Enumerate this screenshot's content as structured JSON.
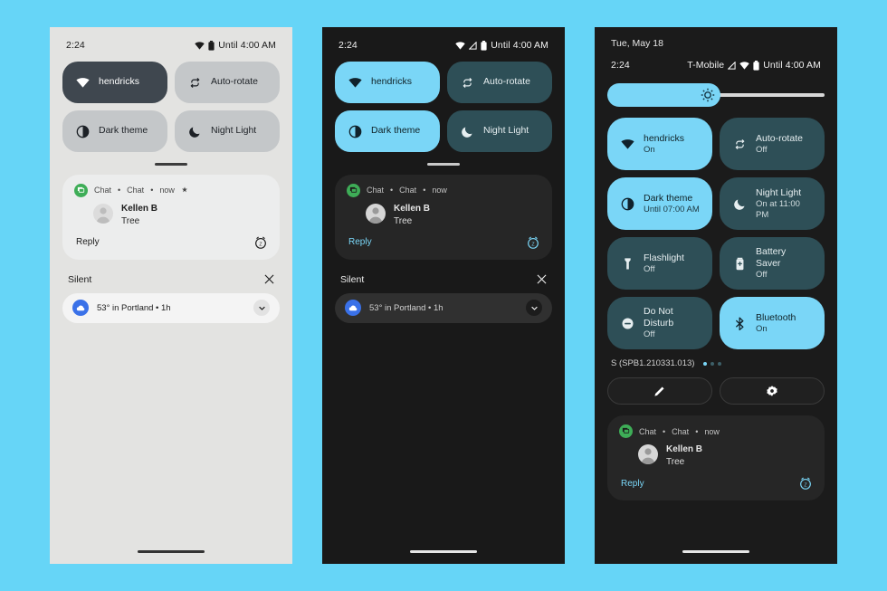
{
  "background_color": "#66d5f7",
  "phones": [
    {
      "id": "phone-light",
      "theme": "light",
      "status": {
        "time": "2:24",
        "battery_text": "Until 4:00 AM"
      },
      "tiles": [
        {
          "label": "hendricks",
          "state": "on",
          "icon": "wifi-icon"
        },
        {
          "label": "Auto-rotate",
          "state": "off",
          "icon": "auto-rotate-icon"
        },
        {
          "label": "Dark theme",
          "state": "off",
          "icon": "dark-theme-icon"
        },
        {
          "label": "Night Light",
          "state": "off",
          "icon": "night-light-icon"
        }
      ],
      "notification": {
        "app": "Chat",
        "channel": "Chat",
        "time": "now",
        "sender": "Kellen B",
        "message": "Tree",
        "reply_label": "Reply"
      },
      "silent": {
        "label": "Silent",
        "clear_icon": "close-icon"
      },
      "weather": {
        "text": "53° in Portland • 1h"
      }
    },
    {
      "id": "phone-dark",
      "theme": "dark",
      "status": {
        "time": "2:24",
        "battery_text": "Until 4:00 AM"
      },
      "tiles": [
        {
          "label": "hendricks",
          "state": "on",
          "icon": "wifi-icon"
        },
        {
          "label": "Auto-rotate",
          "state": "off",
          "icon": "auto-rotate-icon"
        },
        {
          "label": "Dark theme",
          "state": "on",
          "icon": "dark-theme-icon"
        },
        {
          "label": "Night Light",
          "state": "off",
          "icon": "night-light-icon"
        }
      ],
      "notification": {
        "app": "Chat",
        "channel": "Chat",
        "time": "now",
        "sender": "Kellen B",
        "message": "Tree",
        "reply_label": "Reply"
      },
      "silent": {
        "label": "Silent",
        "clear_icon": "close-icon"
      },
      "weather": {
        "text": "53° in Portland • 1h"
      }
    },
    {
      "id": "phone-expanded",
      "theme": "dark",
      "date": "Tue, May 18",
      "status": {
        "time": "2:24",
        "carrier": "T-Mobile",
        "battery_text": "Until 4:00 AM"
      },
      "brightness": {
        "value_percent": 52
      },
      "tiles": [
        {
          "label": "hendricks",
          "sub": "On",
          "state": "on",
          "icon": "wifi-icon"
        },
        {
          "label": "Auto-rotate",
          "sub": "Off",
          "state": "off",
          "icon": "auto-rotate-icon"
        },
        {
          "label": "Dark theme",
          "sub": "Until 07:00 AM",
          "state": "on",
          "icon": "dark-theme-icon"
        },
        {
          "label": "Night Light",
          "sub": "On at 11:00 PM",
          "state": "off",
          "icon": "night-light-icon"
        },
        {
          "label": "Flashlight",
          "sub": "Off",
          "state": "off",
          "icon": "flashlight-icon"
        },
        {
          "label": "Battery Saver",
          "sub": "Off",
          "state": "off",
          "icon": "battery-saver-icon"
        },
        {
          "label": "Do Not Disturb",
          "sub": "Off",
          "state": "off",
          "icon": "do-not-disturb-icon"
        },
        {
          "label": "Bluetooth",
          "sub": "On",
          "state": "on",
          "icon": "bluetooth-icon"
        }
      ],
      "footer": {
        "build": "S (SPB1.210331.013)",
        "page_count": 3,
        "active_page": 1
      },
      "actions": [
        {
          "name": "edit-button",
          "icon": "pencil-icon"
        },
        {
          "name": "settings-button",
          "icon": "gear-icon"
        }
      ],
      "notification": {
        "app": "Chat",
        "channel": "Chat",
        "time": "now",
        "sender": "Kellen B",
        "message": "Tree",
        "reply_label": "Reply"
      }
    }
  ],
  "colors": {
    "accent_blue": "#7ad6f7",
    "tile_off_dark": "#2e4f57",
    "tile_on_light": "#3f474f",
    "tile_off_light": "#c4c7c9",
    "app_badge_green": "#3ead57",
    "weather_badge_blue": "#3a71e8"
  }
}
